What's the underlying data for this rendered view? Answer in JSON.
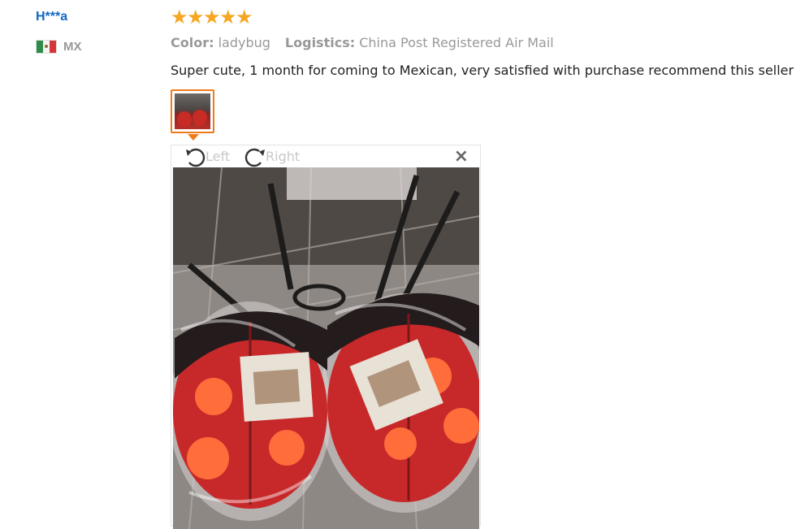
{
  "reviewer": {
    "name": "H***a",
    "country_code": "MX",
    "flag_icon": "mexico-flag-icon"
  },
  "rating": {
    "stars": 5,
    "max": 5,
    "color": "#f5a623"
  },
  "meta": {
    "color_label": "Color:",
    "color_value": "ladybug",
    "logistics_label": "Logistics:",
    "logistics_value": "China Post Registered Air Mail"
  },
  "review": {
    "text": "Super cute, 1 month for coming to Mexican, very satisfied with purchase recommend this seller"
  },
  "viewer": {
    "rotate_left_label": "Left",
    "rotate_right_label": "Right",
    "close_symbol": "×",
    "accent": "#f07a1a"
  }
}
